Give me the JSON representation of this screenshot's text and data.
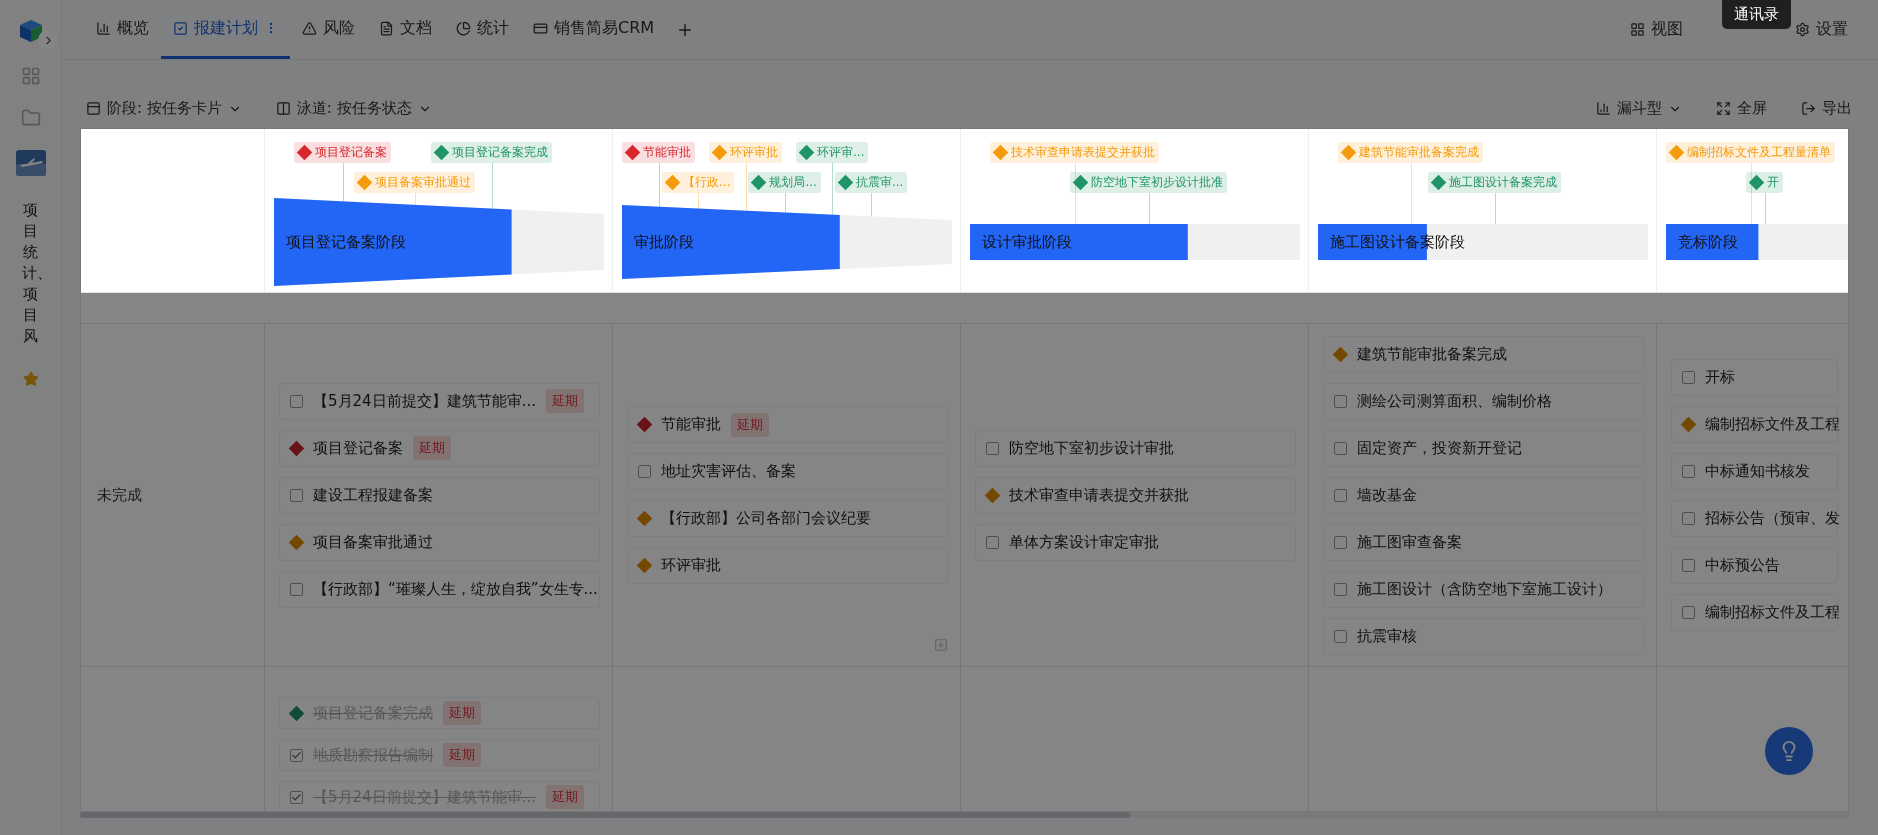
{
  "sidebar": {
    "project_title": "项目统计、项目风",
    "starred": true
  },
  "tabs": [
    {
      "label": "概览",
      "selected": false
    },
    {
      "label": "报建计划",
      "selected": true
    },
    {
      "label": "风险",
      "selected": false
    },
    {
      "label": "文档",
      "selected": false
    },
    {
      "label": "统计",
      "selected": false
    },
    {
      "label": "销售简易CRM",
      "selected": false
    }
  ],
  "header_actions": [
    "视图",
    "设置"
  ],
  "tooltip": "通讯录",
  "toolbar": {
    "stage_filter": "阶段: 按任务卡片",
    "lane_filter": "泳道: 按任务状态",
    "chart_type": "漏斗型",
    "fullscreen": "全屏",
    "export": "导出"
  },
  "stages": [
    {
      "name": "项目登记备案阶段",
      "level": 0.72,
      "milestones_top": [
        {
          "label": "项目登记备案",
          "color": "#d9272e"
        },
        {
          "label": "项目登记备案完成",
          "color": "#1f9468"
        }
      ],
      "milestones_bottom": [
        {
          "label": "项目备案审批通过",
          "color": "#f59a0a"
        }
      ]
    },
    {
      "name": "审批阶段",
      "level": 0.66,
      "milestones_top": [
        {
          "label": "节能审批",
          "color": "#d9272e"
        },
        {
          "label": "环评审批",
          "color": "#f59a0a"
        },
        {
          "label": "环评审...",
          "color": "#1f9468"
        }
      ],
      "milestones_bottom": [
        {
          "label": "【行政...",
          "color": "#f59a0a"
        },
        {
          "label": "规划局...",
          "color": "#1f9468"
        },
        {
          "label": "抗震审...",
          "color": "#1f9468"
        }
      ]
    },
    {
      "name": "设计审批阶段",
      "level": 0.66,
      "milestones_top": [
        {
          "label": "技术审查申请表提交并获批",
          "color": "#f59a0a"
        }
      ],
      "milestones_bottom": [
        {
          "label": "防空地下室初步设计批准",
          "color": "#1f9468"
        }
      ]
    },
    {
      "name": "施工图设计备案阶段",
      "level": 0.33,
      "milestones_top": [
        {
          "label": "建筑节能审批备案完成",
          "color": "#f59a0a"
        }
      ],
      "milestones_bottom": [
        {
          "label": "施工图设计备案完成",
          "color": "#1f9468"
        }
      ]
    },
    {
      "name": "竞标阶段",
      "level": 0.28,
      "milestones_top": [
        {
          "label": "编制招标文件及工程量清单",
          "color": "#f59a0a"
        }
      ],
      "milestones_bottom": [
        {
          "label": "开",
          "color": "#1f9468"
        }
      ]
    }
  ],
  "lanes": [
    {
      "label": "未完成",
      "cells": [
        [
          {
            "kind": "task",
            "label": "【5月24日前提交】建筑节能审...",
            "badge": "延期",
            "done": false
          },
          {
            "kind": "milestone",
            "label": "项目登记备案",
            "color": "#681417",
            "badge": "延期",
            "done": false
          },
          {
            "kind": "task",
            "label": "建设工程报建备案",
            "done": false
          },
          {
            "kind": "milestone",
            "label": "项目备案审批通过",
            "color": "#744800",
            "done": false
          },
          {
            "kind": "task",
            "label": "【行政部】“璀璨人生，绽放自我”女生专...",
            "done": false
          }
        ],
        [
          {
            "kind": "milestone",
            "label": "节能审批",
            "color": "#681417",
            "badge": "延期",
            "done": false
          },
          {
            "kind": "task",
            "label": "地址灾害评估、备案",
            "done": false
          },
          {
            "kind": "milestone",
            "label": "【行政部】公司各部门会议纪要",
            "color": "#744800",
            "done": false
          },
          {
            "kind": "milestone",
            "label": "环评审批",
            "color": "#744800",
            "done": false
          }
        ],
        [
          {
            "kind": "task",
            "label": "防空地下室初步设计审批",
            "done": false
          },
          {
            "kind": "milestone",
            "label": "技术审查申请表提交并获批",
            "color": "#744800",
            "done": false
          },
          {
            "kind": "task",
            "label": "单体方案设计审定审批",
            "done": false
          }
        ],
        [
          {
            "kind": "milestone",
            "label": "建筑节能审批备案完成",
            "color": "#744800",
            "done": false
          },
          {
            "kind": "task",
            "label": "测绘公司测算面积、编制价格",
            "done": false
          },
          {
            "kind": "task",
            "label": "固定资产，投资新开登记",
            "done": false
          },
          {
            "kind": "task",
            "label": "墙改基金",
            "done": false
          },
          {
            "kind": "task",
            "label": "施工图审查备案",
            "done": false
          },
          {
            "kind": "task",
            "label": "施工图设计（含防空地下室施工设计）",
            "done": false
          },
          {
            "kind": "task",
            "label": "抗震审核",
            "done": false
          }
        ],
        [
          {
            "kind": "task",
            "label": "开标",
            "done": false
          },
          {
            "kind": "milestone",
            "label": "编制招标文件及工程",
            "color": "#744800",
            "done": false
          },
          {
            "kind": "task",
            "label": "中标通知书核发",
            "done": false
          },
          {
            "kind": "task",
            "label": "招标公告（预审、发",
            "done": false
          },
          {
            "kind": "task",
            "label": "中标预公告",
            "done": false
          },
          {
            "kind": "task",
            "label": "编制招标文件及工程",
            "done": false
          }
        ]
      ]
    },
    {
      "cells": [
        [
          {
            "kind": "milestone",
            "label": "项目登记备案完成",
            "color": "#104d36",
            "badge": "延期",
            "done": true
          },
          {
            "kind": "task",
            "label": "地质勘察报告编制",
            "badge": "延期",
            "done": true
          },
          {
            "kind": "task",
            "label": "【5月24日前提交】建筑节能审...",
            "badge": "延期",
            "done": true
          }
        ],
        [],
        [],
        [],
        []
      ]
    }
  ]
}
